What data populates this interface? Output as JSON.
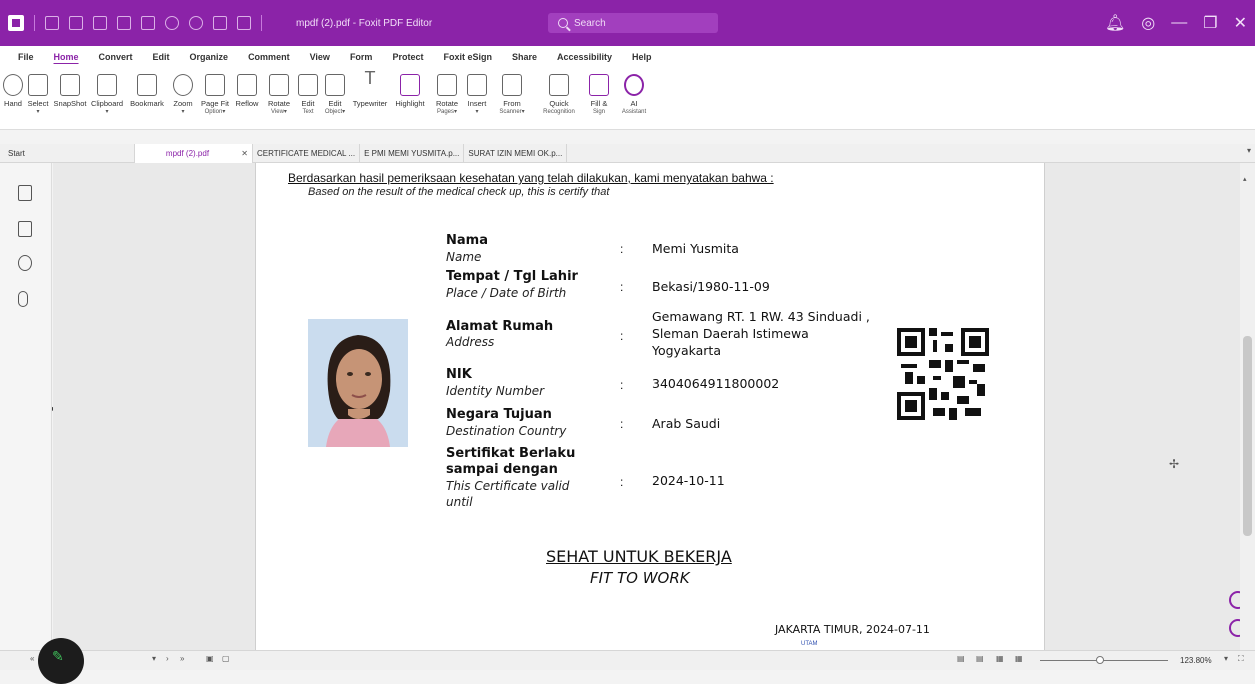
{
  "window": {
    "title": "mpdf (2).pdf - Foxit PDF Editor",
    "search_placeholder": "Search"
  },
  "menu": [
    "File",
    "Home",
    "Convert",
    "Edit",
    "Organize",
    "Comment",
    "View",
    "Form",
    "Protect",
    "Foxit eSign",
    "Share",
    "Accessibility",
    "Help"
  ],
  "ribbon": [
    {
      "label": "Hand",
      "sub": ""
    },
    {
      "label": "Select",
      "sub": "▾"
    },
    {
      "label": "SnapShot",
      "sub": ""
    },
    {
      "label": "Clipboard",
      "sub": "▾"
    },
    {
      "label": "Bookmark",
      "sub": ""
    },
    {
      "label": "Zoom",
      "sub": "▾"
    },
    {
      "label": "Page Fit",
      "sub": "Option▾"
    },
    {
      "label": "Reflow",
      "sub": ""
    },
    {
      "label": "Rotate",
      "sub": "View▾"
    },
    {
      "label": "Edit",
      "sub": "Text"
    },
    {
      "label": "Edit",
      "sub": "Object▾"
    },
    {
      "label": "Typewriter",
      "sub": ""
    },
    {
      "label": "Highlight",
      "sub": ""
    },
    {
      "label": "Rotate",
      "sub": "Pages▾"
    },
    {
      "label": "Insert",
      "sub": "▾"
    },
    {
      "label": "From",
      "sub": "Scanner▾"
    },
    {
      "label": "Quick",
      "sub": "Recognition"
    },
    {
      "label": "Fill &",
      "sub": "Sign"
    },
    {
      "label": "AI",
      "sub": "Assistant"
    }
  ],
  "tabs": {
    "start": "Start",
    "current": "mpdf (2).pdf",
    "others": [
      "CERTIFICATE MEDICAL ...",
      "E PMI MEMI YUSMITA.p...",
      "SURAT IZIN MEMI OK.p..."
    ]
  },
  "document": {
    "intro_id": "Berdasarkan hasil pemeriksaan kesehatan yang telah dilakukan, kami menyatakan bahwa :",
    "intro_en": "Based on the result of the medical check up, this is certify that",
    "fields": [
      {
        "label": "Nama",
        "sub": "Name",
        "value": "Memi Yusmita"
      },
      {
        "label": "Tempat / Tgl Lahir",
        "sub": "Place / Date of Birth",
        "value": "Bekasi/1980-11-09"
      },
      {
        "label": "Alamat Rumah",
        "sub": "Address",
        "value_lines": [
          "Gemawang RT. 1 RW. 43 Sinduadi ,",
          "Sleman Daerah Istimewa",
          "Yogyakarta"
        ]
      },
      {
        "label": "NIK",
        "sub": "Identity Number",
        "value": "3404064911800002"
      },
      {
        "label": "Negara Tujuan",
        "sub": "Destination Country",
        "value": "Arab Saudi"
      },
      {
        "label_lines": [
          "Sertifikat Berlaku",
          "sampai dengan"
        ],
        "sub_lines": [
          "This Certificate valid",
          "until"
        ],
        "value": "2024-10-11"
      }
    ],
    "colon": ":",
    "verdict_id": "SEHAT UNTUK BEKERJA",
    "verdict_en": "FIT TO WORK",
    "place_date": "JAKARTA TIMUR, 2024-07-11",
    "stamp_text": "UTAM"
  },
  "status": {
    "zoom": "123.80%"
  },
  "colors": {
    "accent": "#8b23a8"
  }
}
